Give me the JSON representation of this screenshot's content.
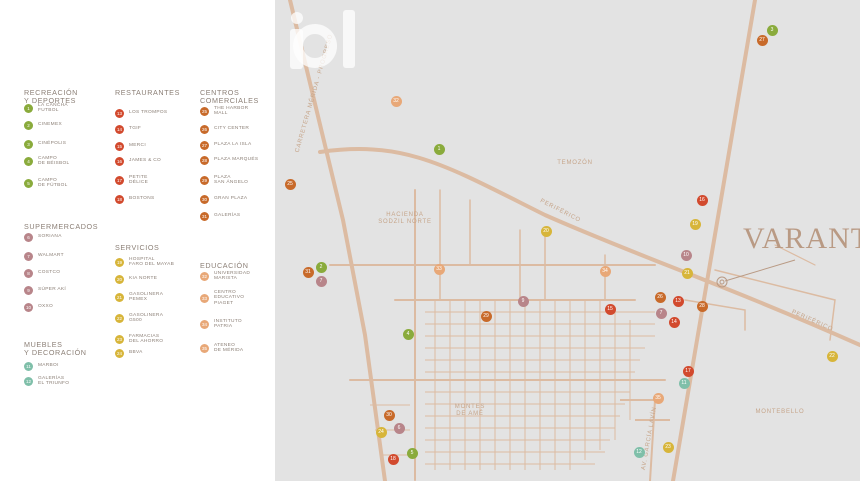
{
  "legend": {
    "sections": [
      {
        "title": "RECREACIÓN\nY DEPORTES",
        "color": "#8aab3c",
        "items": [
          {
            "num": "1",
            "label": "LA CANCHA\nFUTBOL"
          },
          {
            "num": "2",
            "label": "CINEMEX"
          },
          {
            "num": "3",
            "label": "CINÉPOLIS"
          },
          {
            "num": "4",
            "label": "CAMPO\nDE BÉISBOL"
          },
          {
            "num": "5",
            "label": "CAMPO\nDE FÚTBOL"
          }
        ]
      },
      {
        "title": "SUPERMERCADOS",
        "color": "#b8858a",
        "items": [
          {
            "num": "6",
            "label": "SORIANA"
          },
          {
            "num": "7",
            "label": "WALMART"
          },
          {
            "num": "8",
            "label": "COSTCO"
          },
          {
            "num": "9",
            "label": "SÚPER AKÍ"
          },
          {
            "num": "10",
            "label": "OXXO"
          }
        ]
      },
      {
        "title": "MUEBLES\nY DECORACIÓN",
        "color": "#7fbfa9",
        "items": [
          {
            "num": "11",
            "label": "MARBOI"
          },
          {
            "num": "12",
            "label": "GALERÍAS\nEL TRIUNFO"
          }
        ]
      },
      {
        "title": "RESTAURANTES",
        "color": "#d24a2e",
        "items": [
          {
            "num": "13",
            "label": "LOS TROMPOS"
          },
          {
            "num": "14",
            "label": "TGIF"
          },
          {
            "num": "15",
            "label": "MERCI"
          },
          {
            "num": "16",
            "label": "JAMES & CO"
          },
          {
            "num": "17",
            "label": "PETITE\nDÉLICE"
          },
          {
            "num": "18",
            "label": "BOSTONS"
          }
        ]
      },
      {
        "title": "SERVICIOS",
        "color": "#d7b53a",
        "items": [
          {
            "num": "19",
            "label": "HOSPITAL\nFARO DEL MAYAB"
          },
          {
            "num": "20",
            "label": "KIA NORTE"
          },
          {
            "num": "21",
            "label": "GASOLINERA\nPEMEX"
          },
          {
            "num": "22",
            "label": "GASOLINERA\nG500"
          },
          {
            "num": "23",
            "label": "FARMACIAS\nDEL AHORRO"
          },
          {
            "num": "24",
            "label": "BBVA"
          }
        ]
      },
      {
        "title": "CENTROS\nCOMERCIALES",
        "color": "#c86a2a",
        "items": [
          {
            "num": "25",
            "label": "THE HARBOR\nMALL"
          },
          {
            "num": "26",
            "label": "CITY CENTER"
          },
          {
            "num": "27",
            "label": "PLAZA LA ISLA"
          },
          {
            "num": "28",
            "label": "PLAZA MARQUÉS"
          },
          {
            "num": "29",
            "label": "PLAZA\nSAN ÁNGELO"
          },
          {
            "num": "30",
            "label": "GRAN PLAZA"
          },
          {
            "num": "31",
            "label": "GALERÍAS"
          }
        ]
      },
      {
        "title": "EDUCACIÓN",
        "color": "#e8a878",
        "items": [
          {
            "num": "32",
            "label": "UNIVERSIDAD\nMARISTA"
          },
          {
            "num": "33",
            "label": "CENTRO\nEDUCATIVO\nPIAGET"
          },
          {
            "num": "34",
            "label": "INSTITUTO\nPATRIA"
          },
          {
            "num": "35",
            "label": "ATENEO\nDE MÉRIDA"
          }
        ]
      }
    ]
  },
  "map": {
    "labels": {
      "carretera": "CARRETERA MÉRIDA - PROGRESO",
      "temozon": "TEMOZÓN",
      "periferico_1": "PERIFÉRICO",
      "periferico_2": "PERIFÉRICO",
      "hacienda": "HACIENDA\nSODZIL NORTE",
      "montes": "MONTES\nDE AMÉ",
      "montebello": "MONTEBELLO",
      "garcia_lavin": "AV. GARCÍA LAVÍN"
    },
    "brand": "VARANTA",
    "watermark": "iad",
    "markers": [
      {
        "num": "3",
        "cat": 0
      },
      {
        "num": "27",
        "cat": 5
      },
      {
        "num": "32",
        "cat": 6
      },
      {
        "num": "1",
        "cat": 0
      },
      {
        "num": "25",
        "cat": 5
      },
      {
        "num": "16",
        "cat": 3
      },
      {
        "num": "19",
        "cat": 4
      },
      {
        "num": "20",
        "cat": 4
      },
      {
        "num": "10",
        "cat": 1
      },
      {
        "num": "21",
        "cat": 4
      },
      {
        "num": "2",
        "cat": 0
      },
      {
        "num": "31",
        "cat": 5
      },
      {
        "num": "7",
        "cat": 1
      },
      {
        "num": "33",
        "cat": 6
      },
      {
        "num": "34",
        "cat": 6
      },
      {
        "num": "9",
        "cat": 1
      },
      {
        "num": "26",
        "cat": 5
      },
      {
        "num": "13",
        "cat": 3
      },
      {
        "num": "28",
        "cat": 5
      },
      {
        "num": "15",
        "cat": 3
      },
      {
        "num": "29",
        "cat": 5
      },
      {
        "num": "7",
        "cat": 1
      },
      {
        "num": "14",
        "cat": 3
      },
      {
        "num": "4",
        "cat": 0
      },
      {
        "num": "22",
        "cat": 4
      },
      {
        "num": "17",
        "cat": 3
      },
      {
        "num": "11",
        "cat": 2
      },
      {
        "num": "35",
        "cat": 6
      },
      {
        "num": "30",
        "cat": 5
      },
      {
        "num": "6",
        "cat": 1
      },
      {
        "num": "24",
        "cat": 4
      },
      {
        "num": "23",
        "cat": 4
      },
      {
        "num": "12",
        "cat": 2
      },
      {
        "num": "5",
        "cat": 0
      },
      {
        "num": "18",
        "cat": 3
      }
    ]
  }
}
